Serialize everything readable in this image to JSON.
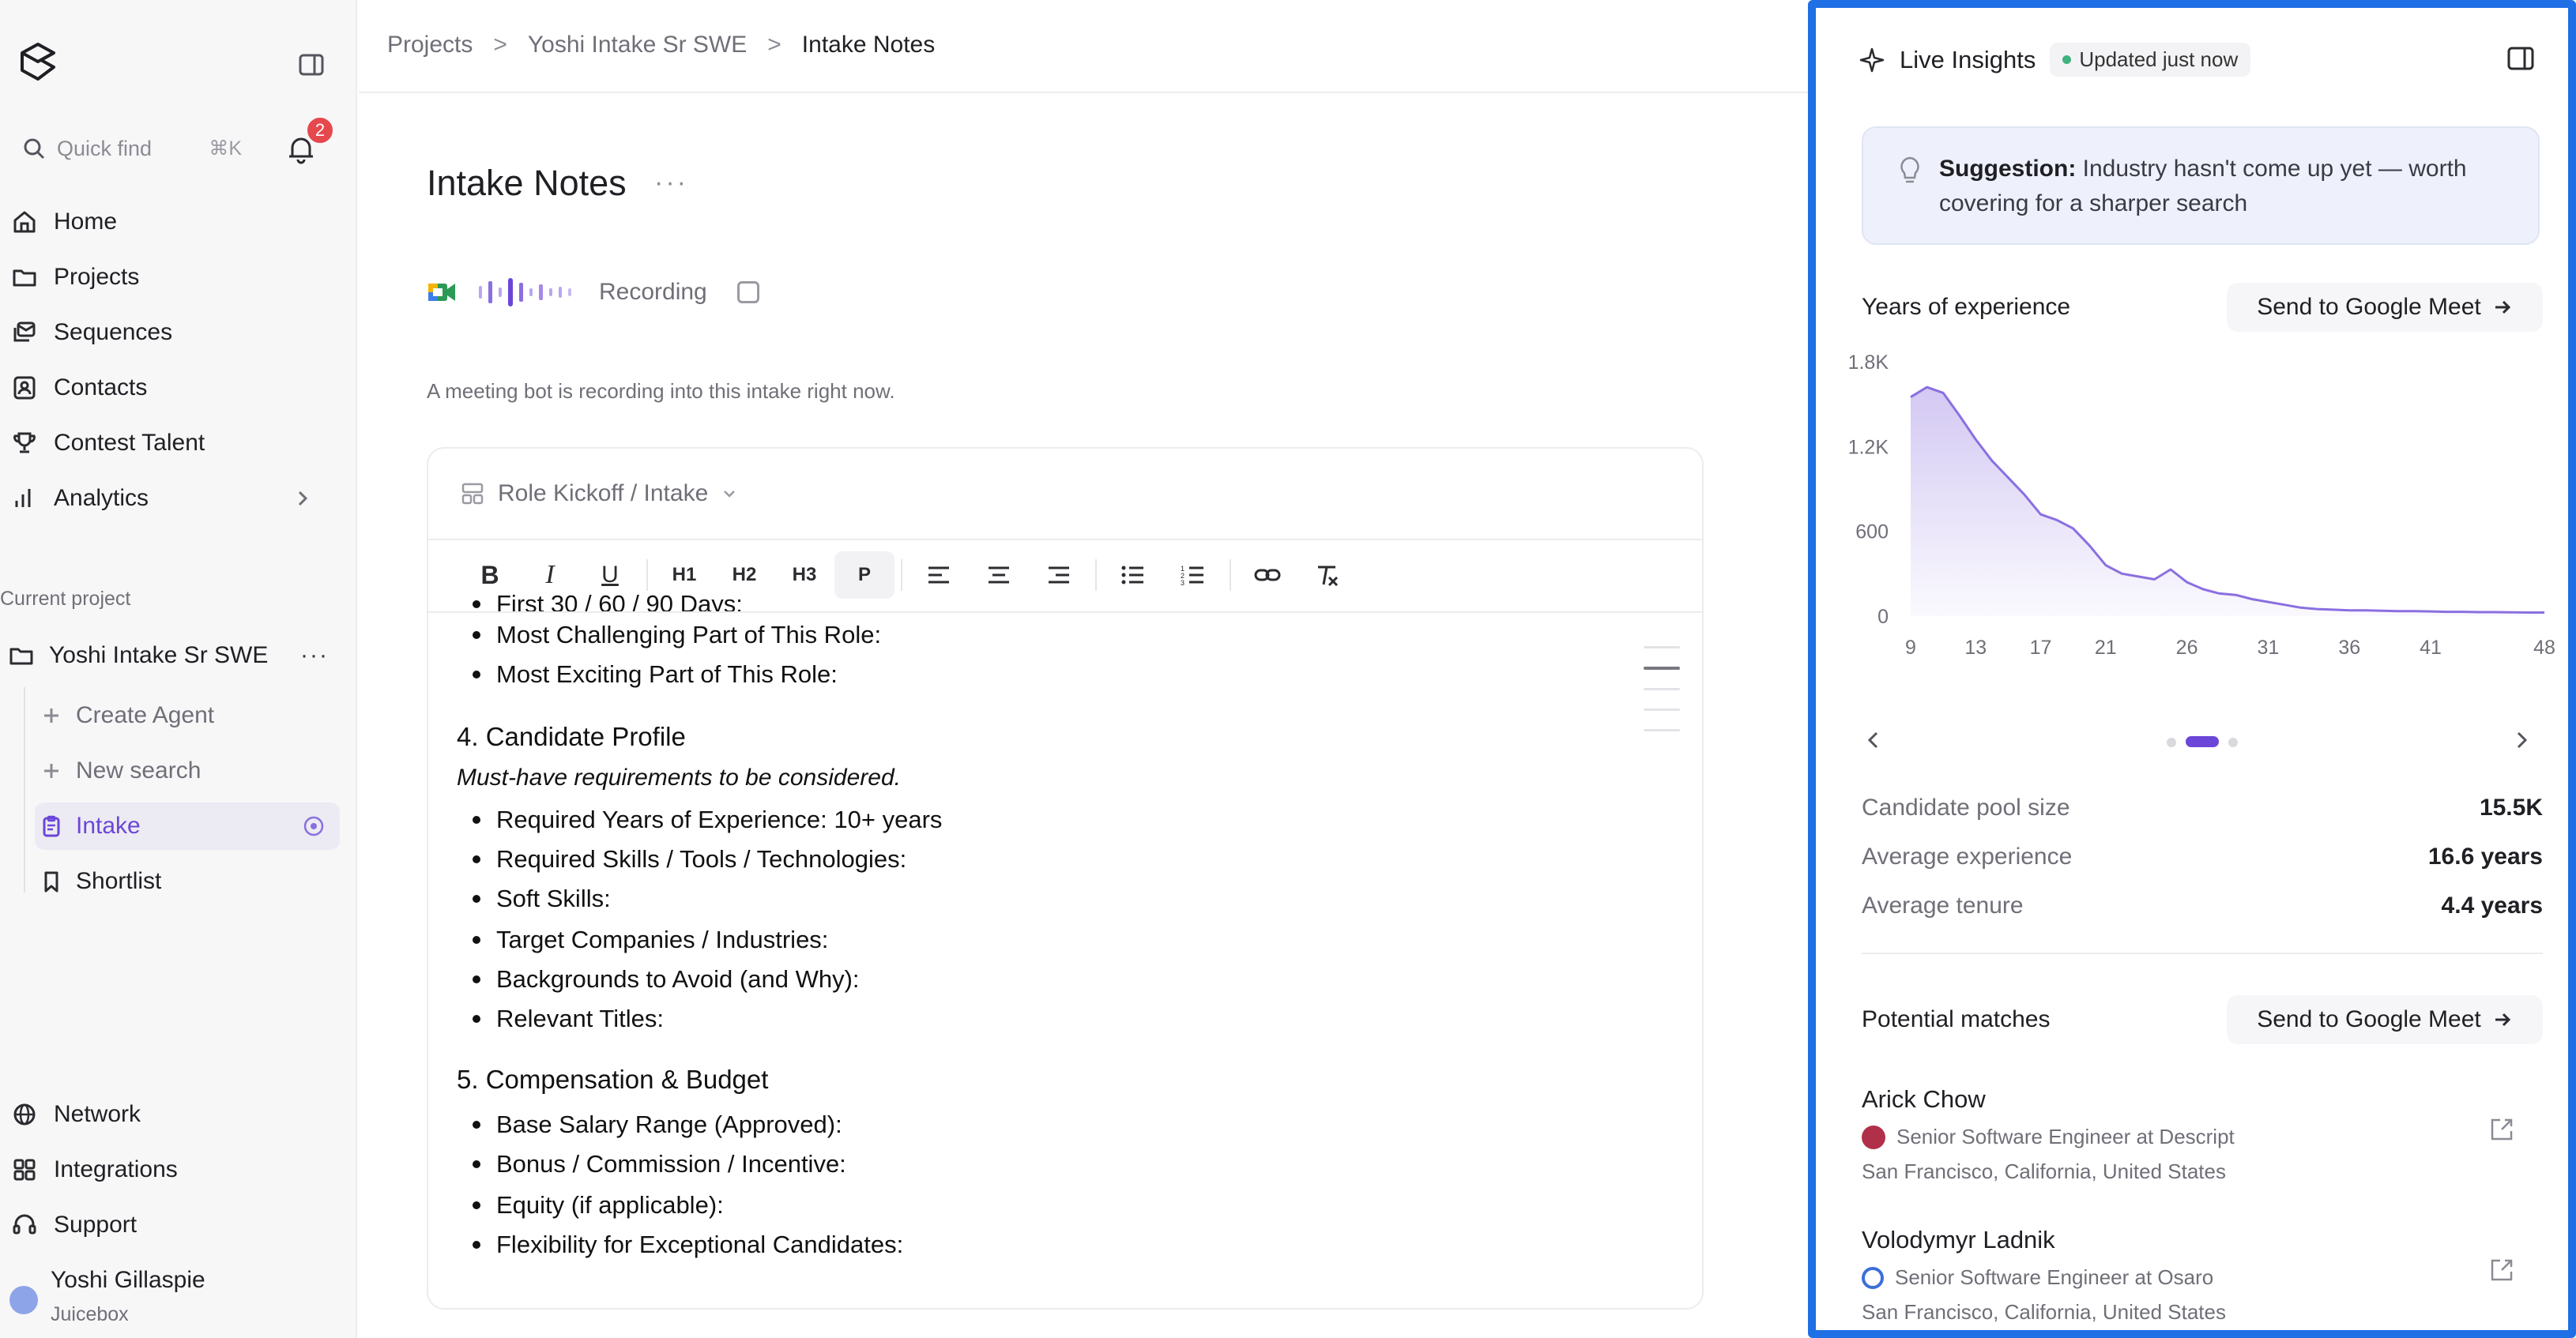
{
  "sidebar": {
    "quick_find": {
      "placeholder": "Quick find",
      "shortcut": "⌘K"
    },
    "notification_count": "2",
    "nav": [
      {
        "label": "Home",
        "icon": "home-icon"
      },
      {
        "label": "Projects",
        "icon": "folder-icon"
      },
      {
        "label": "Sequences",
        "icon": "sequences-icon"
      },
      {
        "label": "Contacts",
        "icon": "contacts-icon"
      },
      {
        "label": "Contest Talent",
        "icon": "trophy-icon"
      },
      {
        "label": "Analytics",
        "icon": "bar-chart-icon"
      }
    ],
    "current_project_label": "Current project",
    "project_name": "Yoshi Intake Sr SWE",
    "sub_items": [
      {
        "label": "Create Agent",
        "icon": "plus-icon"
      },
      {
        "label": "New search",
        "icon": "plus-icon"
      },
      {
        "label": "Intake",
        "icon": "clipboard-icon",
        "active": true
      },
      {
        "label": "Shortlist",
        "icon": "bookmark-icon"
      }
    ],
    "bottom_nav": [
      {
        "label": "Network",
        "icon": "globe-icon"
      },
      {
        "label": "Integrations",
        "icon": "grid-icon"
      },
      {
        "label": "Support",
        "icon": "headset-icon"
      }
    ],
    "user": {
      "name": "Yoshi Gillaspie",
      "org": "Juicebox"
    }
  },
  "main": {
    "breadcrumb": [
      "Projects",
      "Yoshi Intake Sr SWE",
      "Intake Notes"
    ],
    "title": "Intake Notes",
    "recording_label": "Recording",
    "description": "A meeting bot is recording into this intake right now.",
    "template_label": "Role Kickoff / Intake",
    "toolbar": [
      "B",
      "I",
      "U",
      "H1",
      "H2",
      "H3",
      "P"
    ],
    "doc": {
      "partial_line": "First 30 / 60 / 90 Days:",
      "bullets_a": [
        "Most Challenging Part of This Role:",
        "Most Exciting Part of This Role:"
      ],
      "heading_4": "4. Candidate Profile",
      "italic_4": "Must-have requirements to be considered.",
      "bullets_4": [
        "Required Years of Experience: 10+ years",
        "Required Skills / Tools / Technologies:",
        "Soft Skills:",
        "Target Companies / Industries:",
        "Backgrounds to Avoid (and Why):",
        "Relevant Titles:"
      ],
      "heading_5": "5. Compensation & Budget",
      "bullets_5": [
        "Base Salary Range (Approved):",
        "Bonus / Commission / Incentive:",
        "Equity (if applicable):",
        "Flexibility for Exceptional Candidates:"
      ]
    }
  },
  "panel": {
    "title": "Live Insights",
    "updated": "Updated just now",
    "suggestion_label": "Suggestion:",
    "suggestion_text": " Industry hasn't come up yet — worth covering for a sharper search",
    "yoe_title": "Years of experience",
    "send_label": "Send to Google Meet",
    "stats": [
      {
        "label": "Candidate pool size",
        "value": "15.5K"
      },
      {
        "label": "Average experience",
        "value": "16.6 years"
      },
      {
        "label": "Average tenure",
        "value": "4.4 years"
      }
    ],
    "matches_title": "Potential matches",
    "matches": [
      {
        "name": "Arick Chow",
        "role": "Senior Software Engineer at Descript",
        "location": "San Francisco, California, United States",
        "logo_color": "#b0304a"
      },
      {
        "name": "Volodymyr Ladnik",
        "role": "Senior Software Engineer at Osaro",
        "location": "San Francisco, California, United States",
        "logo_color": "#3b6fd8"
      }
    ],
    "accent": "#1f6fe5"
  },
  "chart_data": {
    "type": "area",
    "x": [
      9,
      10,
      11,
      12,
      13,
      14,
      15,
      16,
      17,
      18,
      19,
      20,
      21,
      22,
      23,
      24,
      25,
      26,
      27,
      28,
      29,
      30,
      31,
      32,
      33,
      34,
      35,
      36,
      37,
      38,
      39,
      40,
      41,
      42,
      43,
      44,
      45,
      46,
      47,
      48
    ],
    "series": [
      {
        "values": [
          1550,
          1620,
          1580,
          1420,
          1250,
          1100,
          980,
          860,
          720,
          680,
          620,
          500,
          360,
          300,
          280,
          260,
          330,
          240,
          190,
          160,
          150,
          120,
          100,
          80,
          60,
          50,
          45,
          40,
          40,
          38,
          35,
          35,
          33,
          30,
          30,
          28,
          28,
          26,
          25,
          25
        ]
      }
    ],
    "x_ticks": [
      "9",
      "13",
      "17",
      "21",
      "26",
      "31",
      "36",
      "41",
      "48"
    ],
    "y_ticks": [
      "1.8K",
      "1.2K",
      "600",
      "0"
    ],
    "ylim": [
      0,
      1800
    ],
    "xlim": [
      9,
      48
    ],
    "color": "#8b6fe0",
    "grid": false,
    "title": "Years of experience"
  }
}
